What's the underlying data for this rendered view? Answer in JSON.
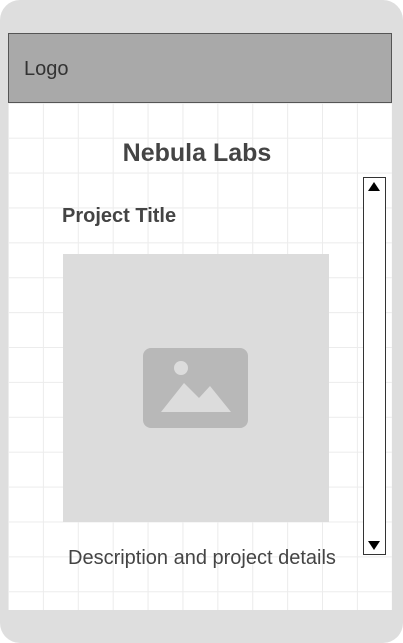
{
  "header": {
    "logo_label": "Logo"
  },
  "main": {
    "site_title": "Nebula Labs",
    "project": {
      "title": "Project Title",
      "image_icon": "image-placeholder-icon",
      "description": "Description and project details"
    }
  },
  "scrollbar": {
    "up_icon": "arrow-up-icon",
    "down_icon": "arrow-down-icon"
  },
  "colors": {
    "device_frame": "#dedede",
    "header_bg": "#a9a9a9",
    "image_placeholder_bg": "#dcdcdc",
    "image_icon": "#b8b8b8",
    "text": "#444444"
  }
}
